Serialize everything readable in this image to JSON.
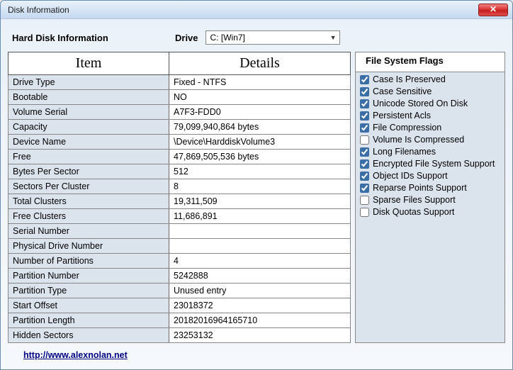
{
  "window": {
    "title": "Disk Information"
  },
  "header": {
    "hd_label": "Hard Disk Information",
    "drive_label": "Drive",
    "drive_value": "C: [Win7]"
  },
  "table": {
    "col_item": "Item",
    "col_details": "Details",
    "rows": [
      {
        "item": "Drive Type",
        "details": "Fixed - NTFS"
      },
      {
        "item": "Bootable",
        "details": "NO"
      },
      {
        "item": "Volume Serial",
        "details": "A7F3-FDD0"
      },
      {
        "item": "Capacity",
        "details": "79,099,940,864 bytes"
      },
      {
        "item": "Device Name",
        "details": "\\Device\\HarddiskVolume3"
      },
      {
        "item": "Free",
        "details": "47,869,505,536 bytes"
      },
      {
        "item": "Bytes Per Sector",
        "details": "512"
      },
      {
        "item": "Sectors Per Cluster",
        "details": "8"
      },
      {
        "item": "Total Clusters",
        "details": "19,311,509"
      },
      {
        "item": "Free Clusters",
        "details": "11,686,891"
      },
      {
        "item": "Serial Number",
        "details": ""
      },
      {
        "item": "Physical Drive Number",
        "details": ""
      },
      {
        "item": "Number of Partitions",
        "details": "4"
      },
      {
        "item": "Partition Number",
        "details": "5242888"
      },
      {
        "item": "Partition Type",
        "details": "Unused entry"
      },
      {
        "item": "Start Offset",
        "details": "23018372"
      },
      {
        "item": "Partition Length",
        "details": "20182016964165710"
      },
      {
        "item": "Hidden Sectors",
        "details": "23253132"
      }
    ]
  },
  "flags": {
    "title": "File System Flags",
    "items": [
      {
        "label": "Case Is Preserved",
        "checked": true
      },
      {
        "label": "Case Sensitive",
        "checked": true
      },
      {
        "label": "Unicode Stored On Disk",
        "checked": true
      },
      {
        "label": "Persistent Acls",
        "checked": true
      },
      {
        "label": "File Compression",
        "checked": true
      },
      {
        "label": "Volume Is Compressed",
        "checked": false
      },
      {
        "label": "Long Filenames",
        "checked": true
      },
      {
        "label": "Encrypted File System Support",
        "checked": true
      },
      {
        "label": "Object IDs Support",
        "checked": true
      },
      {
        "label": "Reparse Points Support",
        "checked": true
      },
      {
        "label": "Sparse Files Support",
        "checked": false
      },
      {
        "label": "Disk Quotas Support",
        "checked": false
      }
    ]
  },
  "footer": {
    "link_text": "http://www.alexnolan.net"
  }
}
